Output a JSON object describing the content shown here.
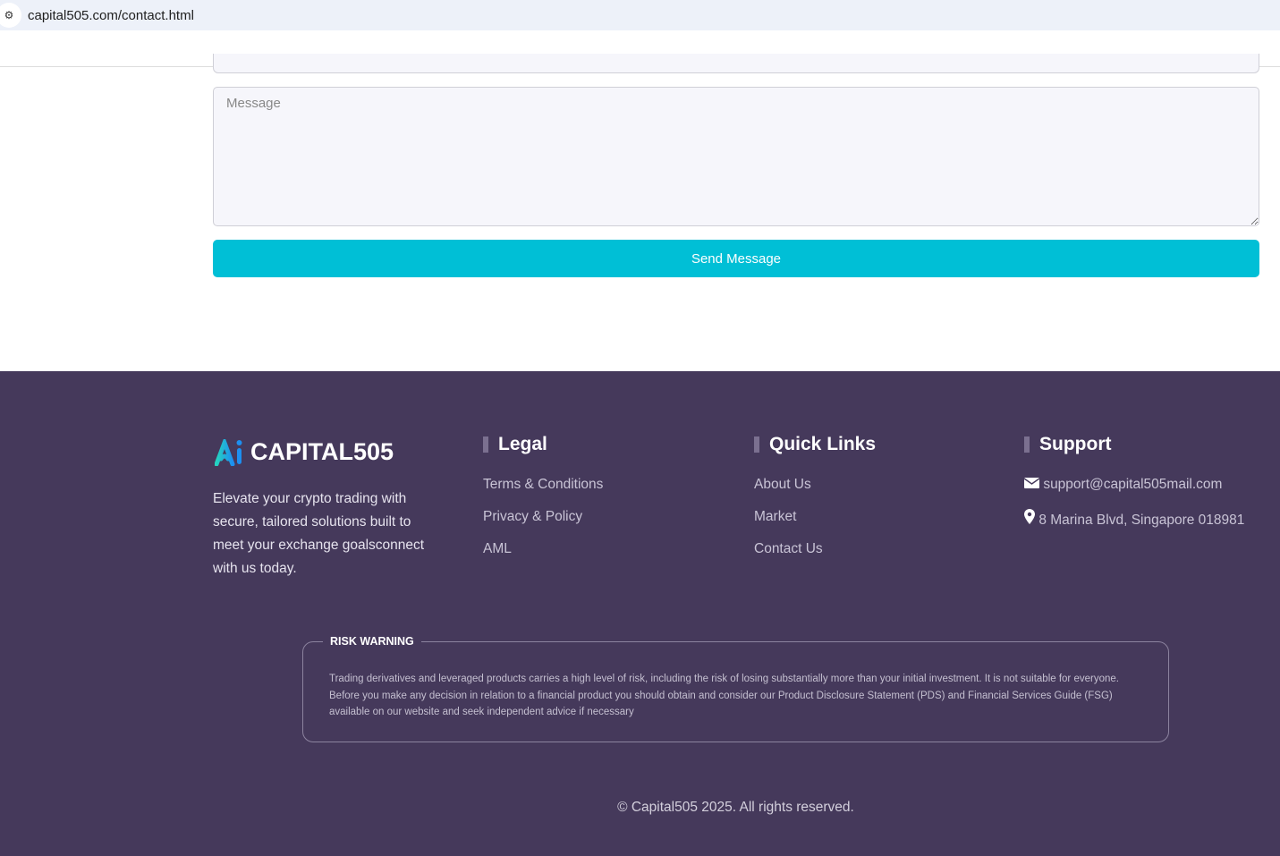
{
  "browser": {
    "url": "capital505.com/contact.html"
  },
  "form": {
    "message_placeholder": "Message",
    "send_label": "Send Message"
  },
  "footer": {
    "brand": "CAPITAL505",
    "about": "Elevate your crypto trading with secure, tailored solutions built to meet your exchange goalsconnect with us today.",
    "legal": {
      "title": "Legal",
      "links": [
        "Terms & Conditions",
        "Privacy & Policy",
        "AML"
      ]
    },
    "quick": {
      "title": "Quick Links",
      "links": [
        "About Us",
        "Market",
        "Contact Us"
      ]
    },
    "support": {
      "title": "Support",
      "email": "support@capital505mail.com",
      "address": "8 Marina Blvd, Singapore 018981"
    },
    "risk": {
      "title": "RISK WARNING",
      "text": "Trading derivatives and leveraged products carries a high level of risk, including the risk of losing substantially more than your initial investment. It is not suitable for everyone. Before you make any decision in relation to a financial product you should obtain and consider our Product Disclosure Statement (PDS) and Financial Services Guide (FSG) available on our website and seek independent advice if necessary"
    },
    "copyright": "© Capital505 2025. All rights reserved."
  },
  "colors": {
    "accent": "#00bfd6",
    "footer_bg": "#45395b"
  }
}
